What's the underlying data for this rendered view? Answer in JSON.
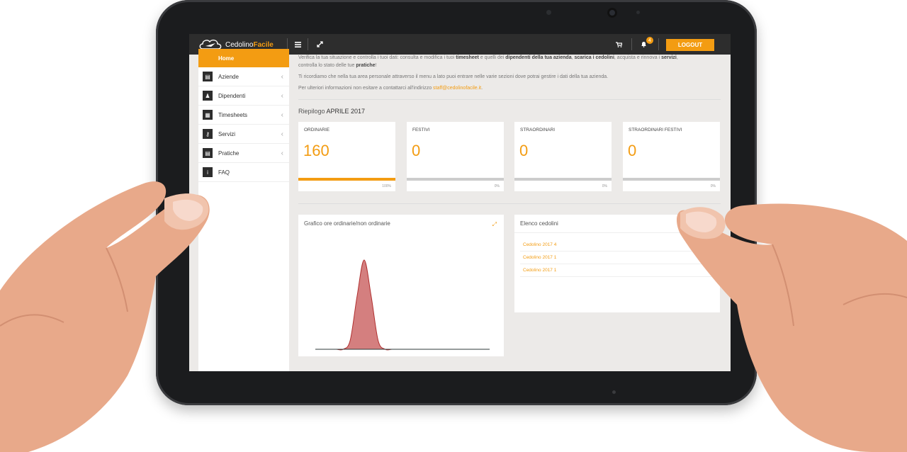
{
  "app": {
    "logo_main": "Cedolino",
    "logo_accent": "Facile",
    "brand_color": "#f39c12",
    "topbar_color": "#2d2d2d"
  },
  "topbar": {
    "menu_icon": "hamburger-icon",
    "fullscreen_icon": "expand-icon",
    "cart_icon": "cart-icon",
    "bell_icon": "bell-icon",
    "notification_count": "4",
    "logout_label": "LOGOUT"
  },
  "sidebar": {
    "items": [
      {
        "label": "Home",
        "icon": "home-icon",
        "active": true
      },
      {
        "label": "Aziende",
        "icon": "building-icon"
      },
      {
        "label": "Dipendenti",
        "icon": "users-icon"
      },
      {
        "label": "Timesheets",
        "icon": "calendar-icon"
      },
      {
        "label": "Servizi",
        "icon": "key-icon"
      },
      {
        "label": "Pratiche",
        "icon": "file-icon"
      },
      {
        "label": "FAQ",
        "icon": "info-icon"
      }
    ]
  },
  "intro": {
    "line1_a": "Verifica la tua situazione e controlla i tuoi dati: consulta e modifica i tuoi ",
    "line1_b": "timesheet",
    "line1_c": " e quelli dei ",
    "line1_d": "dipendenti della tua azienda",
    "line1_e": ", ",
    "line1_f": "scarica i cedolini",
    "line1_g": ", acquista e rinnova i ",
    "line1_h": "servizi",
    "line1_i": ",",
    "line2_a": "controlla lo stato delle tue ",
    "line2_b": "pratiche",
    "line2_c": "!",
    "line3": "Ti ricordiamo che nella tua area personale attraverso il menu a lato puoi entrare nelle varie sezioni dove potrai gestire i dati della tua azienda.",
    "line4": "Per ulteriori informazioni non esitare a contattarci all'indirizzo ",
    "email": "staff@cedolinofacile.it",
    "line4_end": "."
  },
  "riepilogo": {
    "label": "Riepilogo ",
    "period": "APRILE 2017"
  },
  "cards": [
    {
      "title": "ORDINARIE",
      "value": "160",
      "percent": "100%",
      "fill": 1.0
    },
    {
      "title": "FESTIVI",
      "value": "0",
      "percent": "0%",
      "fill": 0
    },
    {
      "title": "STRAORDINARI",
      "value": "0",
      "percent": "0%",
      "fill": 0
    },
    {
      "title": "STRAORDINARI FESTIVI",
      "value": "0",
      "percent": "0%",
      "fill": 0
    }
  ],
  "chart_panel": {
    "title": "Grafico ore ordinarie/non ordinarie",
    "expand_icon": "expand-icon"
  },
  "chart_data": {
    "type": "area",
    "title": "Grafico ore ordinarie/non ordinarie",
    "fill_color": "#d47f7f",
    "stroke_color": "#b03030",
    "series": [
      {
        "values": [
          0,
          0,
          0,
          0,
          0,
          0.1,
          0.6,
          1.0,
          0.6,
          0.1,
          0,
          0,
          0,
          0,
          0,
          0,
          0,
          0,
          0,
          0,
          0,
          0,
          0,
          0,
          0,
          0
        ]
      }
    ]
  },
  "cedolini_panel": {
    "title": "Elenco cedolini",
    "items": [
      "Cedolino 2017 4",
      "Cedolino 2017 1",
      "Cedolino 2017 1"
    ]
  }
}
